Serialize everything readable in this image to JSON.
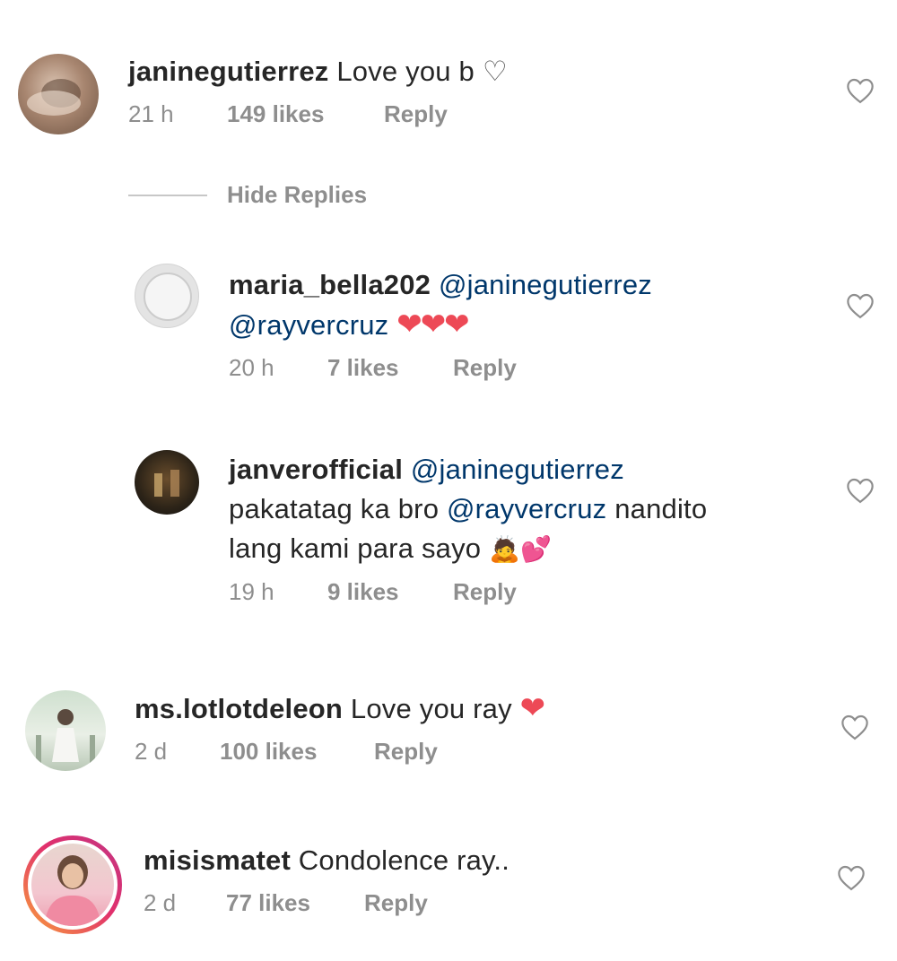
{
  "comments": [
    {
      "username": "janinegutierrez",
      "text": "Love you b",
      "text_suffix": "♡",
      "time": "21 h",
      "likes": "149 likes",
      "reply": "Reply"
    },
    {
      "username": "maria_bella202",
      "mention1": "@janinegutierrez",
      "mention2": "@rayvercruz",
      "emoji": "❤❤❤",
      "time": "20 h",
      "likes": "7 likes",
      "reply": "Reply"
    },
    {
      "username": "janverofficial",
      "mention1": "@janinegutierrez",
      "text1": "pakatatag ka bro",
      "mention2": "@rayvercruz",
      "text2": "nandito",
      "text3": "lang kami para sayo",
      "emoji": "🙇💕",
      "time": "19 h",
      "likes": "9 likes",
      "reply": "Reply"
    },
    {
      "username": "ms.lotlotdeleon",
      "text": "Love you ray",
      "emoji": "❤",
      "time": "2 d",
      "likes": "100 likes",
      "reply": "Reply"
    },
    {
      "username": "misismatet",
      "text": "Condolence ray..",
      "time": "2 d",
      "likes": "77 likes",
      "reply": "Reply"
    }
  ],
  "hide_replies_label": "Hide Replies",
  "colors": {
    "mention": "#00376b",
    "meta": "#8e8e8e",
    "heart_red": "#ed4956",
    "story_ring": "#c13584"
  },
  "icons": {
    "like": "heart-outline-icon",
    "emoji_heart": "red-heart-emoji"
  }
}
